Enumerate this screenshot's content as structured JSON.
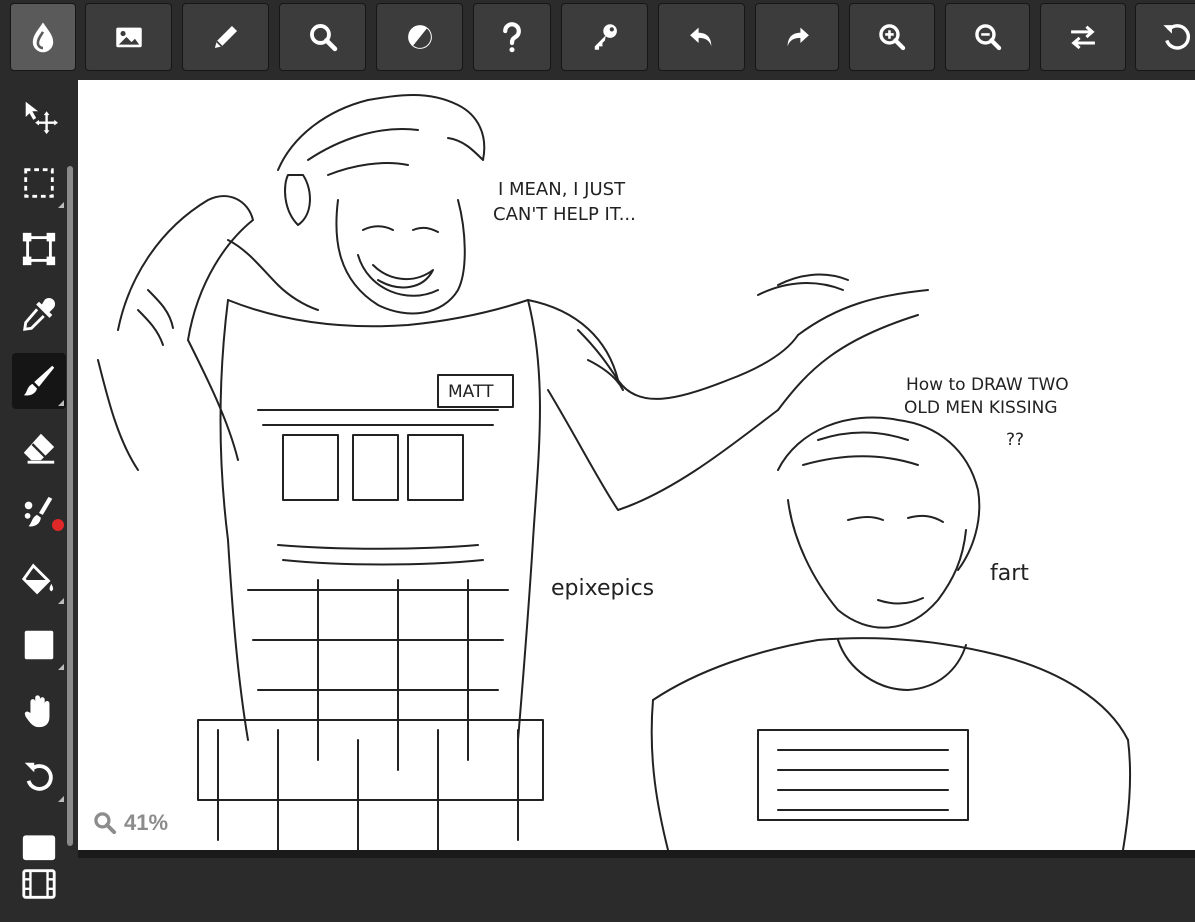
{
  "toolbar": {
    "buttons": [
      {
        "icon": "app-drop-icon"
      },
      {
        "icon": "image-icon"
      },
      {
        "icon": "pencil-icon"
      },
      {
        "icon": "search-icon"
      },
      {
        "icon": "contrast-icon"
      },
      {
        "icon": "help-icon"
      },
      {
        "icon": "key-icon"
      },
      {
        "icon": "undo-icon"
      },
      {
        "icon": "redo-icon"
      },
      {
        "icon": "zoom-in-icon"
      },
      {
        "icon": "zoom-out-icon"
      },
      {
        "icon": "swap-icon"
      },
      {
        "icon": "rotate-icon"
      }
    ]
  },
  "tools": [
    {
      "icon": "move-icon"
    },
    {
      "icon": "select-icon"
    },
    {
      "icon": "transform-icon"
    },
    {
      "icon": "eyedropper-icon"
    },
    {
      "icon": "brush-icon",
      "selected": true
    },
    {
      "icon": "eraser-icon"
    },
    {
      "icon": "smudge-icon",
      "badge_color": "#e02828"
    },
    {
      "icon": "fill-icon"
    },
    {
      "icon": "shape-icon"
    },
    {
      "icon": "hand-icon"
    },
    {
      "icon": "rotate-view-icon"
    },
    {
      "icon": "color-icon"
    },
    {
      "icon": "filmstrip-icon"
    }
  ],
  "canvas": {
    "speech_line1": "I MEAN, I JUST",
    "speech_line2": "CAN'T HELP IT...",
    "name_tag": "MATT",
    "note_line1": "How to DRAW TWO",
    "note_line2": "OLD MEN KISSING",
    "note_line3": "??",
    "signature": "epixepics",
    "fart": "fart"
  },
  "zoom": {
    "label": "41%"
  },
  "colors": {
    "ui_bg": "#2b2b2b",
    "button_bg": "#3c3c3c",
    "icon": "#ffffff",
    "badge": "#e02828"
  }
}
